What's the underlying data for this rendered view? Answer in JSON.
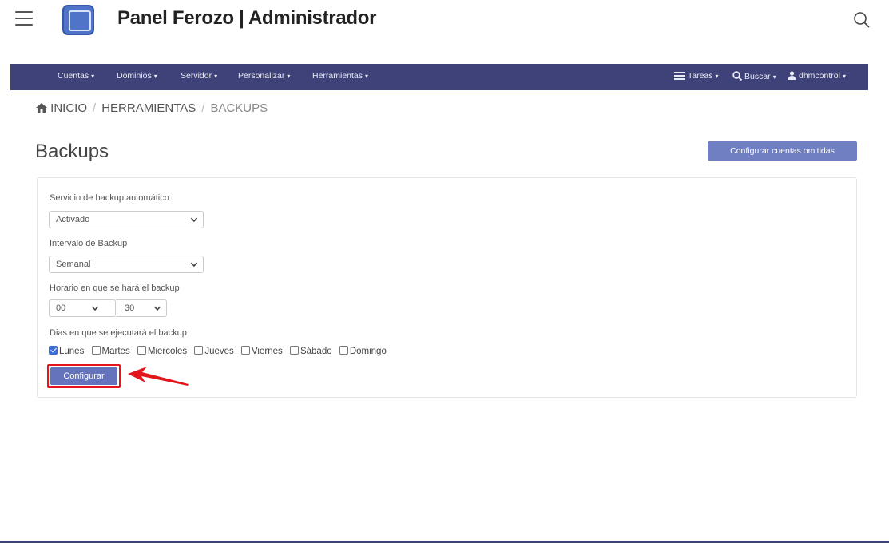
{
  "app": {
    "title": "Panel Ferozo | Administrador",
    "menu_icon": "hamburger-icon",
    "logo_icon": "panel-logo-icon",
    "search_icon": "search-icon"
  },
  "nav": {
    "left": [
      {
        "label": "Cuentas"
      },
      {
        "label": "Dominios"
      },
      {
        "label": "Servidor"
      },
      {
        "label": "Personalizar"
      },
      {
        "label": "Herramientas"
      }
    ],
    "right": [
      {
        "label": "Tareas",
        "icon": "tasks-icon"
      },
      {
        "label": "Buscar",
        "icon": "search-icon"
      },
      {
        "label": "dhmcontrol",
        "icon": "user-icon"
      }
    ],
    "background": "#3e4278"
  },
  "breadcrumb": {
    "home_icon": "home-icon",
    "items": [
      "INICIO",
      "HERRAMIENTAS",
      "BACKUPS"
    ],
    "separator": "/"
  },
  "page": {
    "title": "Backups",
    "omit_button": "Configurar cuentas omitidas"
  },
  "form": {
    "auto_service": {
      "label": "Servicio de backup automático",
      "value": "Activado"
    },
    "interval": {
      "label": "Intervalo de Backup",
      "value": "Semanal"
    },
    "schedule": {
      "label": "Horario en que se hará el backup",
      "hour": "00",
      "separator": ":",
      "minute": "30"
    },
    "days": {
      "label": "Dias en que se ejecutará el backup",
      "options": [
        {
          "label": "Lunes",
          "checked": true
        },
        {
          "label": "Martes",
          "checked": false
        },
        {
          "label": "Miercoles",
          "checked": false
        },
        {
          "label": "Jueves",
          "checked": false
        },
        {
          "label": "Viernes",
          "checked": false
        },
        {
          "label": "Sábado",
          "checked": false
        },
        {
          "label": "Domingo",
          "checked": false
        }
      ]
    },
    "submit": "Configurar"
  },
  "annotations": {
    "highlight_color": "#e3151a",
    "arrow_color": "#e3151a"
  },
  "colors": {
    "accent": "#6473bb",
    "button_secondary": "#6f7fc2",
    "checkbox": "#3b6fd6"
  }
}
